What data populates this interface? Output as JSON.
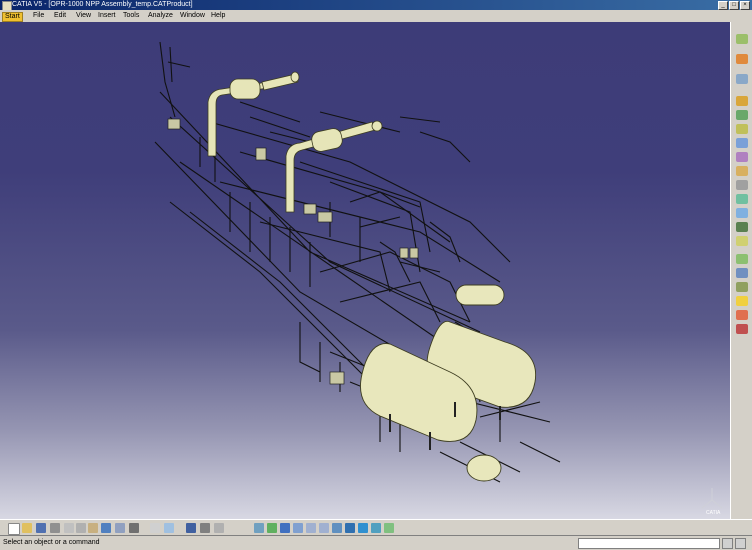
{
  "window": {
    "title": "CATIA V5 - [OPR-1000 NPP Assembly_temp.CATProduct]"
  },
  "menu": [
    {
      "label": "Start"
    },
    {
      "label": "File"
    },
    {
      "label": "Edit"
    },
    {
      "label": "View"
    },
    {
      "label": "Insert"
    },
    {
      "label": "Tools"
    },
    {
      "label": "Analyze"
    },
    {
      "label": "Window"
    },
    {
      "label": "Help"
    }
  ],
  "toolbar_right": {
    "icons": [
      "sketch-icon",
      "assembly-icon",
      "component-icon",
      "product-icon",
      "part-icon",
      "existing-component-icon",
      "replace-icon",
      "graph-tree-icon",
      "generate-numbering-icon",
      "bill-of-material-icon",
      "scenes-icon",
      "constraint-icon",
      "fix-icon",
      "coincidence-icon",
      "contact-icon",
      "offset-icon",
      "angle-icon",
      "update-icon",
      "snap-icon",
      "clash-icon"
    ]
  },
  "toolbar_bottom": {
    "icons": [
      "new-icon",
      "open-icon",
      "save-icon",
      "print-icon",
      "cut-icon",
      "copy-icon",
      "paste-icon",
      "undo-icon",
      "redo-icon",
      "whats-this-icon",
      "formula-icon",
      "knowledge-icon",
      "catalog-icon",
      "measure-icon",
      "sectioning-icon",
      "fly-mode-icon",
      "fit-all-icon",
      "pan-icon",
      "rotate-icon",
      "zoom-in-icon",
      "zoom-out-icon",
      "normal-view-icon",
      "iso-view-icon",
      "shading-icon",
      "hide-show-icon",
      "swap-visible-space-icon"
    ]
  },
  "status": {
    "text": "Select an object or a command",
    "command_input": ""
  },
  "colors": {
    "viewport_top": "#3d3c78",
    "viewport_bottom": "#d8d8e3",
    "model_fill": "#e6e5b8",
    "model_line": "#111111"
  },
  "compass": {
    "label": "CATIA"
  }
}
